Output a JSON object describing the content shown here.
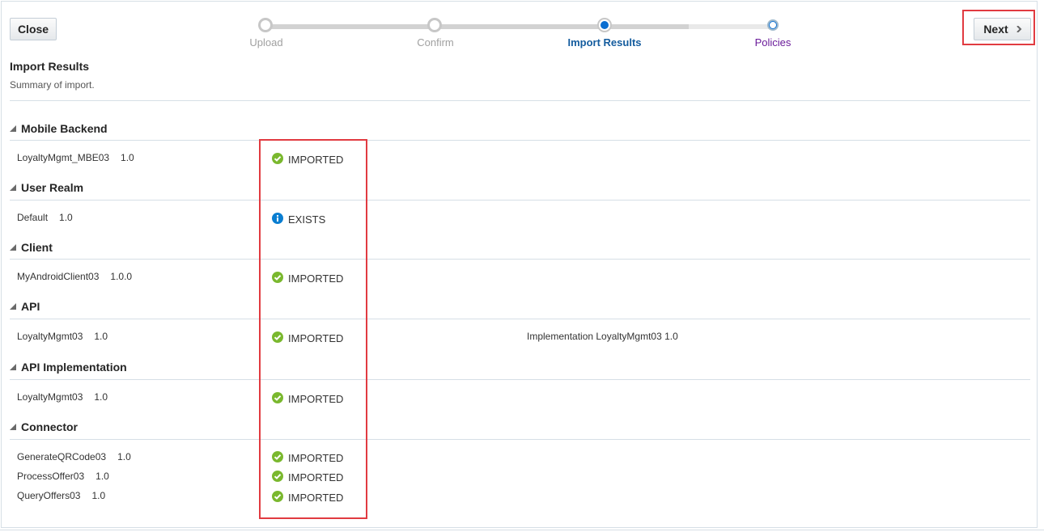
{
  "toolbar": {
    "close_label": "Close",
    "next_label": "Next"
  },
  "train": {
    "stops": [
      {
        "label": "Upload",
        "state": "visited"
      },
      {
        "label": "Confirm",
        "state": "visited"
      },
      {
        "label": "Import Results",
        "state": "current"
      },
      {
        "label": "Policies",
        "state": "unvisited"
      }
    ]
  },
  "page": {
    "title": "Import Results",
    "subtitle": "Summary of import."
  },
  "sections": [
    {
      "title": "Mobile Backend",
      "items": [
        {
          "name": "LoyaltyMgmt_MBE03",
          "version": "1.0",
          "status": "IMPORTED",
          "status_icon": "check-circle-icon"
        }
      ]
    },
    {
      "title": "User Realm",
      "items": [
        {
          "name": "Default",
          "version": "1.0",
          "status": "EXISTS",
          "status_icon": "info-icon"
        }
      ]
    },
    {
      "title": "Client",
      "items": [
        {
          "name": "MyAndroidClient03",
          "version": "1.0.0",
          "status": "IMPORTED",
          "status_icon": "check-circle-icon"
        }
      ]
    },
    {
      "title": "API",
      "items": [
        {
          "name": "LoyaltyMgmt03",
          "version": "1.0",
          "status": "IMPORTED",
          "status_icon": "check-circle-icon",
          "detail": "Implementation LoyaltyMgmt03 1.0"
        }
      ]
    },
    {
      "title": "API Implementation",
      "items": [
        {
          "name": "LoyaltyMgmt03",
          "version": "1.0",
          "status": "IMPORTED",
          "status_icon": "check-circle-icon"
        }
      ]
    },
    {
      "title": "Connector",
      "items": [
        {
          "name": "GenerateQRCode03",
          "version": "1.0",
          "status": "IMPORTED",
          "status_icon": "check-circle-icon"
        },
        {
          "name": "ProcessOffer03",
          "version": "1.0",
          "status": "IMPORTED",
          "status_icon": "check-circle-icon"
        },
        {
          "name": "QueryOffers03",
          "version": "1.0",
          "status": "IMPORTED",
          "status_icon": "check-circle-icon"
        }
      ]
    }
  ],
  "colors": {
    "success": "#7ab82e",
    "info": "#0a7ed1",
    "highlight": "#e13b41",
    "train_current": "#145c9e",
    "train_next": "#6a1b9a"
  }
}
